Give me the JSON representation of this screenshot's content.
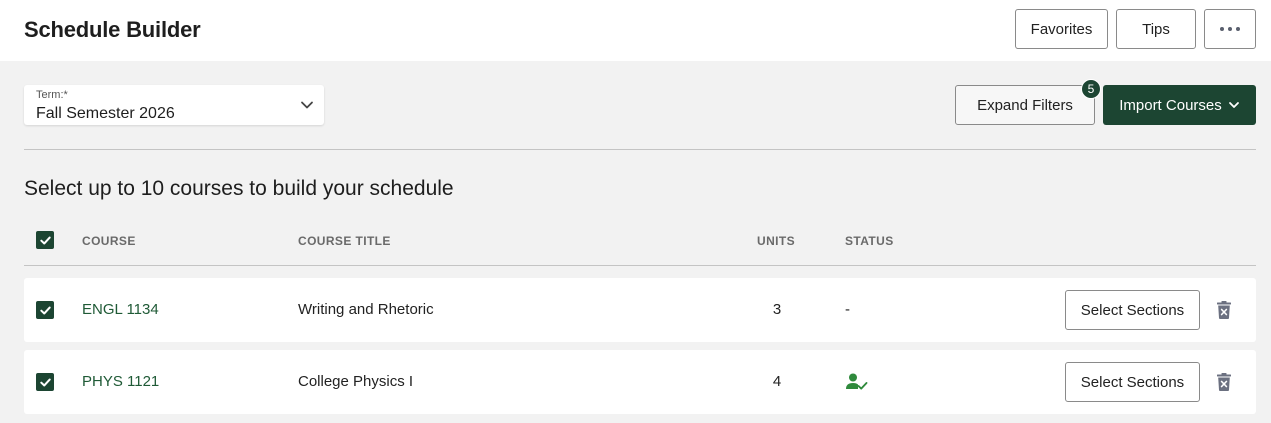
{
  "header": {
    "title": "Schedule Builder",
    "favorites_label": "Favorites",
    "tips_label": "Tips"
  },
  "term": {
    "label": "Term:*",
    "value": "Fall Semester 2026"
  },
  "filters": {
    "expand_label": "Expand Filters",
    "count": "5"
  },
  "import": {
    "label": "Import Courses"
  },
  "course_list": {
    "heading": "Select up to 10 courses to build your schedule",
    "columns": {
      "course": "COURSE",
      "title": "COURSE TITLE",
      "units": "UNITS",
      "status": "STATUS"
    },
    "rows": [
      {
        "code": "ENGL 1134",
        "title": "Writing and Rhetoric",
        "units": "3",
        "status": "-",
        "checked": true,
        "select_label": "Select Sections"
      },
      {
        "code": "PHYS 1121",
        "title": "College Physics I",
        "units": "4",
        "status": "",
        "status_icon": "user-check-icon",
        "checked": true,
        "select_label": "Select Sections"
      }
    ]
  },
  "colors": {
    "accent": "#1c4532",
    "course_link": "#1f5a36",
    "status_ok": "#2f8a3c",
    "trash": "#6b7080"
  }
}
